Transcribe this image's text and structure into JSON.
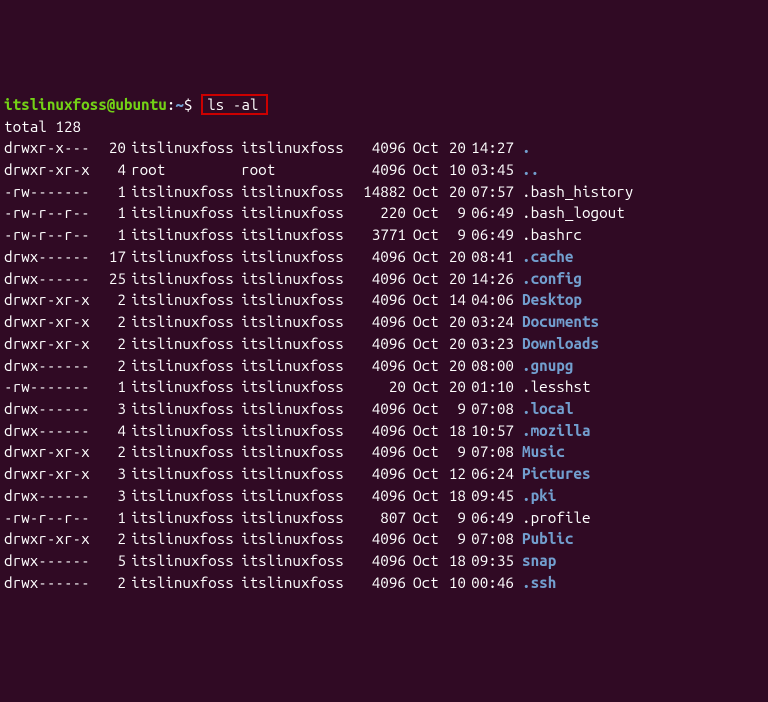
{
  "prompt": {
    "user_host": "itslinuxfoss@ubuntu",
    "separator": ":",
    "path": "~",
    "symbol": "$ ",
    "command": "ls -al"
  },
  "total_line": "total 128",
  "entries": [
    {
      "perms": "drwxr-x---",
      "links": "20",
      "owner": "itslinuxfoss",
      "group": "itslinuxfoss",
      "size": "4096",
      "month": "Oct",
      "day": "20",
      "time": "14:27",
      "name": ".",
      "is_dir": true
    },
    {
      "perms": "drwxr-xr-x",
      "links": "4",
      "owner": "root",
      "group": "root",
      "size": "4096",
      "month": "Oct",
      "day": "10",
      "time": "03:45",
      "name": "..",
      "is_dir": true
    },
    {
      "perms": "-rw-------",
      "links": "1",
      "owner": "itslinuxfoss",
      "group": "itslinuxfoss",
      "size": "14882",
      "month": "Oct",
      "day": "20",
      "time": "07:57",
      "name": ".bash_history",
      "is_dir": false
    },
    {
      "perms": "-rw-r--r--",
      "links": "1",
      "owner": "itslinuxfoss",
      "group": "itslinuxfoss",
      "size": "220",
      "month": "Oct",
      "day": "9",
      "time": "06:49",
      "name": ".bash_logout",
      "is_dir": false
    },
    {
      "perms": "-rw-r--r--",
      "links": "1",
      "owner": "itslinuxfoss",
      "group": "itslinuxfoss",
      "size": "3771",
      "month": "Oct",
      "day": "9",
      "time": "06:49",
      "name": ".bashrc",
      "is_dir": false
    },
    {
      "perms": "drwx------",
      "links": "17",
      "owner": "itslinuxfoss",
      "group": "itslinuxfoss",
      "size": "4096",
      "month": "Oct",
      "day": "20",
      "time": "08:41",
      "name": ".cache",
      "is_dir": true
    },
    {
      "perms": "drwx------",
      "links": "25",
      "owner": "itslinuxfoss",
      "group": "itslinuxfoss",
      "size": "4096",
      "month": "Oct",
      "day": "20",
      "time": "14:26",
      "name": ".config",
      "is_dir": true
    },
    {
      "perms": "drwxr-xr-x",
      "links": "2",
      "owner": "itslinuxfoss",
      "group": "itslinuxfoss",
      "size": "4096",
      "month": "Oct",
      "day": "14",
      "time": "04:06",
      "name": "Desktop",
      "is_dir": true
    },
    {
      "perms": "drwxr-xr-x",
      "links": "2",
      "owner": "itslinuxfoss",
      "group": "itslinuxfoss",
      "size": "4096",
      "month": "Oct",
      "day": "20",
      "time": "03:24",
      "name": "Documents",
      "is_dir": true
    },
    {
      "perms": "drwxr-xr-x",
      "links": "2",
      "owner": "itslinuxfoss",
      "group": "itslinuxfoss",
      "size": "4096",
      "month": "Oct",
      "day": "20",
      "time": "03:23",
      "name": "Downloads",
      "is_dir": true
    },
    {
      "perms": "drwx------",
      "links": "2",
      "owner": "itslinuxfoss",
      "group": "itslinuxfoss",
      "size": "4096",
      "month": "Oct",
      "day": "20",
      "time": "08:00",
      "name": ".gnupg",
      "is_dir": true
    },
    {
      "perms": "-rw-------",
      "links": "1",
      "owner": "itslinuxfoss",
      "group": "itslinuxfoss",
      "size": "20",
      "month": "Oct",
      "day": "20",
      "time": "01:10",
      "name": ".lesshst",
      "is_dir": false
    },
    {
      "perms": "drwx------",
      "links": "3",
      "owner": "itslinuxfoss",
      "group": "itslinuxfoss",
      "size": "4096",
      "month": "Oct",
      "day": "9",
      "time": "07:08",
      "name": ".local",
      "is_dir": true
    },
    {
      "perms": "drwx------",
      "links": "4",
      "owner": "itslinuxfoss",
      "group": "itslinuxfoss",
      "size": "4096",
      "month": "Oct",
      "day": "18",
      "time": "10:57",
      "name": ".mozilla",
      "is_dir": true
    },
    {
      "perms": "drwxr-xr-x",
      "links": "2",
      "owner": "itslinuxfoss",
      "group": "itslinuxfoss",
      "size": "4096",
      "month": "Oct",
      "day": "9",
      "time": "07:08",
      "name": "Music",
      "is_dir": true
    },
    {
      "perms": "drwxr-xr-x",
      "links": "3",
      "owner": "itslinuxfoss",
      "group": "itslinuxfoss",
      "size": "4096",
      "month": "Oct",
      "day": "12",
      "time": "06:24",
      "name": "Pictures",
      "is_dir": true
    },
    {
      "perms": "drwx------",
      "links": "3",
      "owner": "itslinuxfoss",
      "group": "itslinuxfoss",
      "size": "4096",
      "month": "Oct",
      "day": "18",
      "time": "09:45",
      "name": ".pki",
      "is_dir": true
    },
    {
      "perms": "-rw-r--r--",
      "links": "1",
      "owner": "itslinuxfoss",
      "group": "itslinuxfoss",
      "size": "807",
      "month": "Oct",
      "day": "9",
      "time": "06:49",
      "name": ".profile",
      "is_dir": false
    },
    {
      "perms": "drwxr-xr-x",
      "links": "2",
      "owner": "itslinuxfoss",
      "group": "itslinuxfoss",
      "size": "4096",
      "month": "Oct",
      "day": "9",
      "time": "07:08",
      "name": "Public",
      "is_dir": true
    },
    {
      "perms": "drwx------",
      "links": "5",
      "owner": "itslinuxfoss",
      "group": "itslinuxfoss",
      "size": "4096",
      "month": "Oct",
      "day": "18",
      "time": "09:35",
      "name": "snap",
      "is_dir": true
    },
    {
      "perms": "drwx------",
      "links": "2",
      "owner": "itslinuxfoss",
      "group": "itslinuxfoss",
      "size": "4096",
      "month": "Oct",
      "day": "10",
      "time": "00:46",
      "name": ".ssh",
      "is_dir": true
    }
  ]
}
